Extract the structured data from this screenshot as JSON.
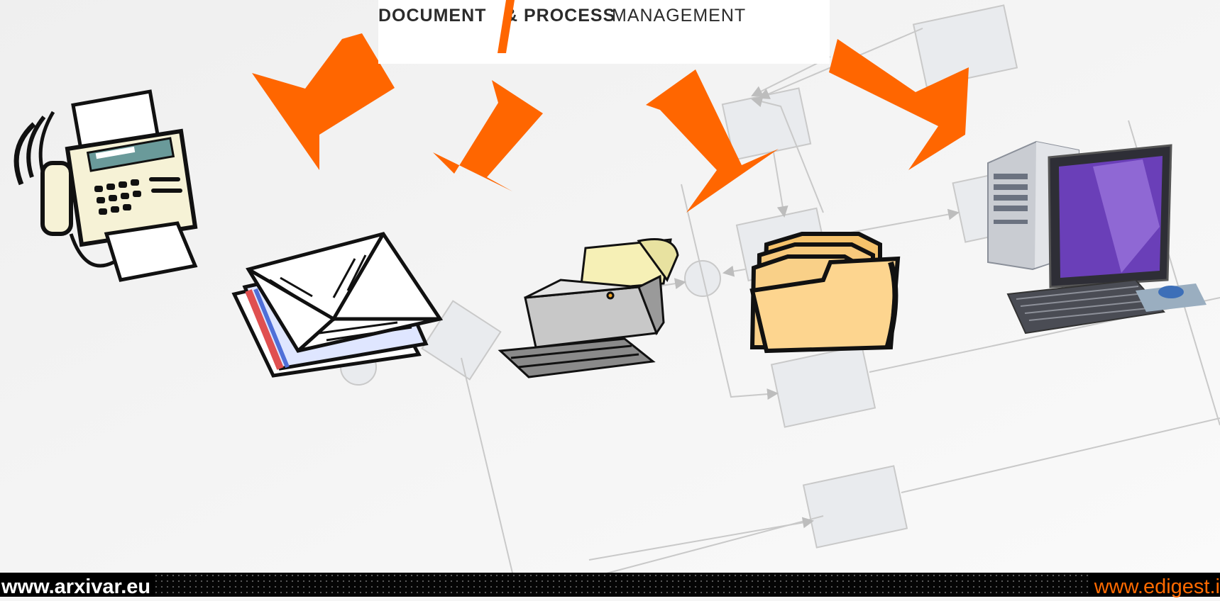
{
  "logo": {
    "tagline_word1": "DOCUMENT",
    "tagline_word2": "& PROCESS",
    "tagline_word3": "MANAGEMENT",
    "accent_color": "#ff6600"
  },
  "icons": [
    "fax-machine-icon",
    "mail-envelopes-icon",
    "printer-icon",
    "folders-icon",
    "desktop-computer-icon"
  ],
  "arrow_color": "#ff6600",
  "footer": {
    "left_url": "www.arxivar.eu",
    "right_url": "www.edigest.i",
    "right_color": "#ff6a00"
  }
}
